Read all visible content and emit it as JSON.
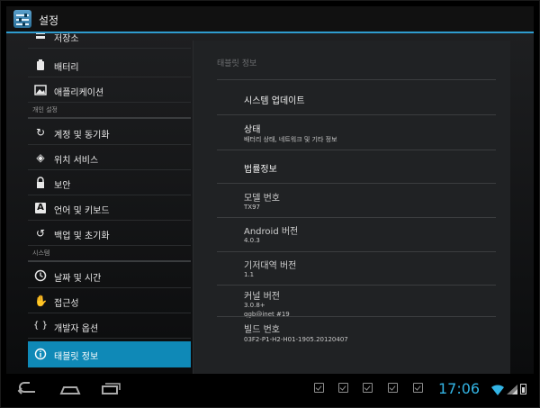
{
  "app": {
    "title": "설정"
  },
  "sidebar": {
    "items": [
      {
        "icon": "storage-icon",
        "label": "저장소"
      },
      {
        "icon": "battery-icon",
        "label": "배터리"
      },
      {
        "icon": "apps-icon",
        "label": "애플리케이션"
      },
      {
        "header": "개인 설정"
      },
      {
        "icon": "sync-icon",
        "label": "계정 및 동기화"
      },
      {
        "icon": "location-icon",
        "label": "위치 서비스"
      },
      {
        "icon": "lock-icon",
        "label": "보안"
      },
      {
        "icon": "keyboard-icon",
        "label": "언어 및 키보드"
      },
      {
        "icon": "backup-icon",
        "label": "백업 및 초기화"
      },
      {
        "header": "시스템"
      },
      {
        "icon": "clock-icon",
        "label": "날짜 및 시간"
      },
      {
        "icon": "hand-icon",
        "label": "접근성"
      },
      {
        "icon": "braces-icon",
        "label": "개발자 옵션"
      },
      {
        "icon": "info-icon",
        "label": "태블릿 정보",
        "active": true
      }
    ],
    "icon_glyphs": {
      "battery": "■",
      "sync": "↻",
      "location": "◈",
      "lock": "■",
      "keyboard": "A",
      "backup": "↺",
      "clock": "◷",
      "hand": "✋",
      "braces": "{ }",
      "info": "ⓘ"
    }
  },
  "detail": {
    "title": "태블릿 정보",
    "items": [
      {
        "title": "시스템 업데이트"
      },
      {
        "title": "상태",
        "subtitle": "배터리 상태, 네트워크 및 기타 정보"
      },
      {
        "title": "법률정보"
      },
      {
        "title": "모델 번호",
        "subtitle": "TX97"
      },
      {
        "title": "Android 버전",
        "subtitle": "4.0.3"
      },
      {
        "title": "기저대역 버전",
        "subtitle": "1.1"
      },
      {
        "title": "커널 버전",
        "subtitle": "3.0.8+",
        "subtitle2": "qgb@inet #19"
      },
      {
        "title": "빌드 번호",
        "subtitle": "03F2-P1-H2-H01-1905.20120407"
      }
    ]
  },
  "statusbar": {
    "time": "17:06"
  },
  "colors": {
    "accent": "#33b5e5",
    "active_item": "#0f89b7",
    "action_bar_line": "#2f9ccf"
  }
}
